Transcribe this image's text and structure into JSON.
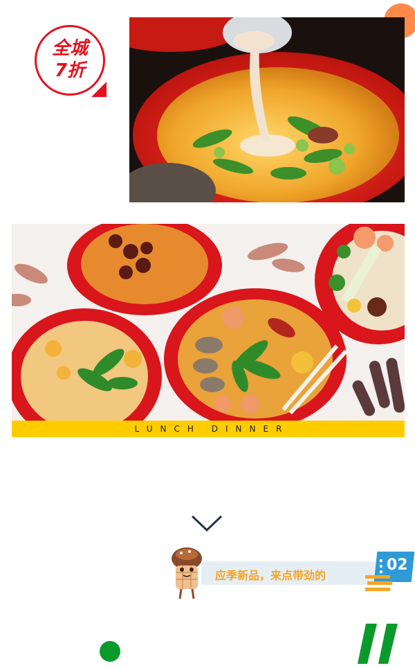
{
  "promo": {
    "line1": "全城",
    "line2": "7折"
  },
  "photos": {
    "top_icon": "soup-pour-photo",
    "spread_icon": "noodle-bowls-photo"
  },
  "caption": {
    "text": "LUNCH DINNER"
  },
  "section": {
    "title": "应季新品，来点带劲的",
    "number": "02"
  },
  "colors": {
    "brand_red": "#e3121e",
    "accent_orange": "#ff8a4a",
    "caption_yellow": "#ffcc00",
    "banner_blue": "#2e9bd6",
    "banner_text": "#f5a623",
    "accent_green": "#0a9a2c",
    "chevron_navy": "#1f3552"
  }
}
